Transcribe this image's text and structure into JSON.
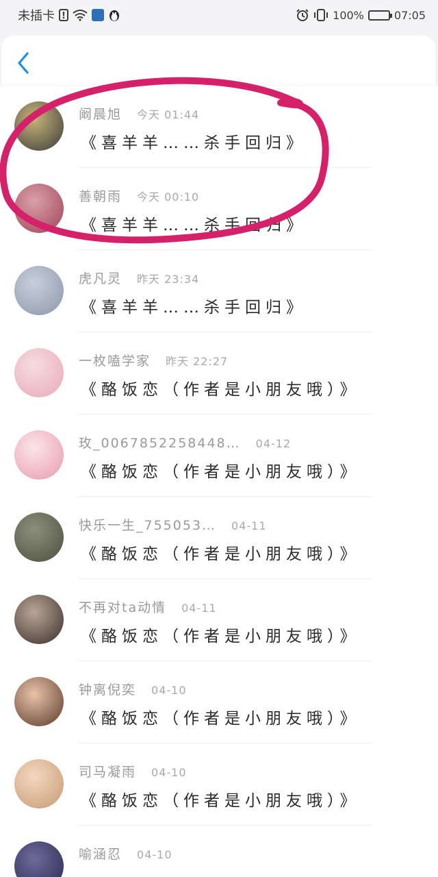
{
  "status_bar": {
    "carrier": "未插卡",
    "battery_percent": "100%",
    "time": "07:05"
  },
  "header": {
    "back_icon": "chevron-left-icon",
    "accent_color": "#1a8fe3"
  },
  "annotation_color": "#d5206a",
  "items": [
    {
      "name": "阚晨旭",
      "time": "今天 01:44",
      "message": "《喜羊羊……杀手回归》",
      "avatar_colors": [
        "#c9b57a",
        "#3a3a3a"
      ]
    },
    {
      "name": "善朝雨",
      "time": "今天 00:10",
      "message": "《喜羊羊……杀手回归》",
      "avatar_colors": [
        "#d9a0a8",
        "#a04458"
      ]
    },
    {
      "name": "虎凡灵",
      "time": "昨天 23:34",
      "message": "《喜羊羊……杀手回归》",
      "avatar_colors": [
        "#c7d0dc",
        "#8c96a8"
      ]
    },
    {
      "name": "一枚嗑学家",
      "time": "昨天 22:27",
      "message": "《酪饭恋（作者是小朋友哦）》",
      "avatar_colors": [
        "#f6dce2",
        "#e8a9b8"
      ]
    },
    {
      "name": "玫_0067852258448…",
      "time": "04-12",
      "message": "《酪饭恋（作者是小朋友哦）》",
      "avatar_colors": [
        "#fbe5ea",
        "#e99aad"
      ]
    },
    {
      "name": "快乐一生_755053…",
      "time": "04-11",
      "message": "《酪饭恋（作者是小朋友哦）》",
      "avatar_colors": [
        "#8b8f7a",
        "#4b4f3e"
      ]
    },
    {
      "name": "不再对ta动情",
      "time": "04-11",
      "message": "《酪饭恋（作者是小朋友哦）》",
      "avatar_colors": [
        "#b9a595",
        "#3a2f2b"
      ]
    },
    {
      "name": "钟离倪奕",
      "time": "04-10",
      "message": "《酪饭恋（作者是小朋友哦）》",
      "avatar_colors": [
        "#e9c2a8",
        "#5a3a2a"
      ]
    },
    {
      "name": "司马凝雨",
      "time": "04-10",
      "message": "《酪饭恋（作者是小朋友哦）》",
      "avatar_colors": [
        "#f3d8c0",
        "#c79a74"
      ]
    },
    {
      "name": "喻涵忍",
      "time": "04-10",
      "message": "",
      "avatar_colors": [
        "#6f6a9a",
        "#2a2850"
      ]
    }
  ]
}
